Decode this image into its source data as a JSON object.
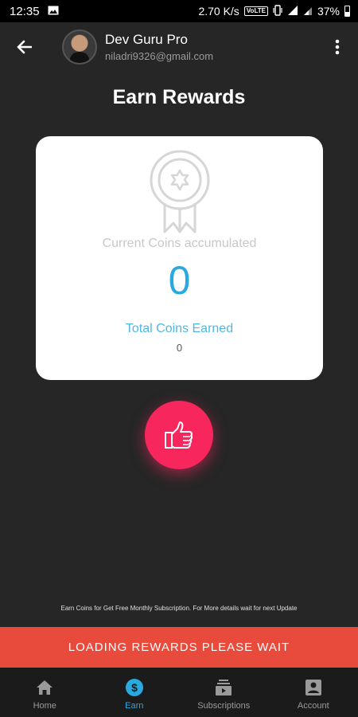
{
  "status_bar": {
    "time": "12:35",
    "network_speed": "2.70 K/s",
    "volte": "VoLTE",
    "battery_percent": "37%"
  },
  "header": {
    "user_name": "Dev Guru Pro",
    "user_email": "niladri9326@gmail.com"
  },
  "page": {
    "title": "Earn Rewards"
  },
  "card": {
    "current_label": "Current Coins accumulated",
    "current_value": "0",
    "total_label": "Total Coins Earned",
    "total_value": "0"
  },
  "info_text": "Earn Coins for Get Free Monthly Subscription. For More details wait for next Update",
  "loading_text": "LOADING REWARDS PLEASE WAIT",
  "bottom_nav": {
    "items": [
      {
        "label": "Home",
        "icon": "home-icon"
      },
      {
        "label": "Earn",
        "icon": "dollar-icon"
      },
      {
        "label": "Subscriptions",
        "icon": "subscriptions-icon"
      },
      {
        "label": "Account",
        "icon": "account-icon"
      }
    ],
    "active": "Earn"
  },
  "colors": {
    "background": "#262626",
    "accent_blue": "#29a9e0",
    "like_button": "#f7265c",
    "loading_bar": "#e84a3c"
  }
}
